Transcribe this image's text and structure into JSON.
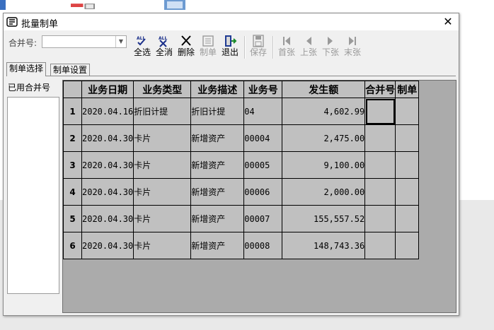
{
  "window": {
    "title": "批量制单",
    "close_glyph": "✕"
  },
  "toolbar": {
    "merge_label": "合并号:",
    "merge_value": "",
    "buttons": {
      "select_all": "全选",
      "deselect_all": "全消",
      "delete": "删除",
      "make": "制单",
      "exit": "退出",
      "save": "保存",
      "first": "首张",
      "prev": "上张",
      "next": "下张",
      "last": "末张"
    }
  },
  "tabs": [
    {
      "label": "制单选择",
      "active": true
    },
    {
      "label": "制单设置",
      "active": false
    }
  ],
  "left_panel": {
    "label": "已用合并号",
    "items": []
  },
  "grid": {
    "columns": [
      "业务日期",
      "业务类型",
      "业务描述",
      "业务号",
      "发生额",
      "合并号",
      "制单"
    ],
    "rows": [
      {
        "n": "1",
        "date": "2020.04.16",
        "type": "折旧计提",
        "desc": "折旧计提",
        "no": "04",
        "amount": "4,602.99",
        "merge": "",
        "make": ""
      },
      {
        "n": "2",
        "date": "2020.04.30",
        "type": "卡片",
        "desc": "新增资产",
        "no": "00004",
        "amount": "2,475.00",
        "merge": "",
        "make": ""
      },
      {
        "n": "3",
        "date": "2020.04.30",
        "type": "卡片",
        "desc": "新增资产",
        "no": "00005",
        "amount": "9,100.00",
        "merge": "",
        "make": ""
      },
      {
        "n": "4",
        "date": "2020.04.30",
        "type": "卡片",
        "desc": "新增资产",
        "no": "00006",
        "amount": "2,000.00",
        "merge": "",
        "make": ""
      },
      {
        "n": "5",
        "date": "2020.04.30",
        "type": "卡片",
        "desc": "新增资产",
        "no": "00007",
        "amount": "155,557.52",
        "merge": "",
        "make": ""
      },
      {
        "n": "6",
        "date": "2020.04.30",
        "type": "卡片",
        "desc": "新增资产",
        "no": "00008",
        "amount": "148,743.36",
        "merge": "",
        "make": ""
      }
    ]
  },
  "colors": {
    "grid_bg": "#ababab",
    "cell_bg": "#c0c0c0",
    "window_bg": "#f0f0f0",
    "desktop_band": "#e9e9e9"
  },
  "icons": [
    "app-icon",
    "close-icon",
    "select-all-icon",
    "deselect-all-icon",
    "delete-icon",
    "make-voucher-icon",
    "exit-icon",
    "save-icon",
    "first-icon",
    "prev-icon",
    "next-icon",
    "last-icon",
    "dropdown-arrow-icon"
  ]
}
